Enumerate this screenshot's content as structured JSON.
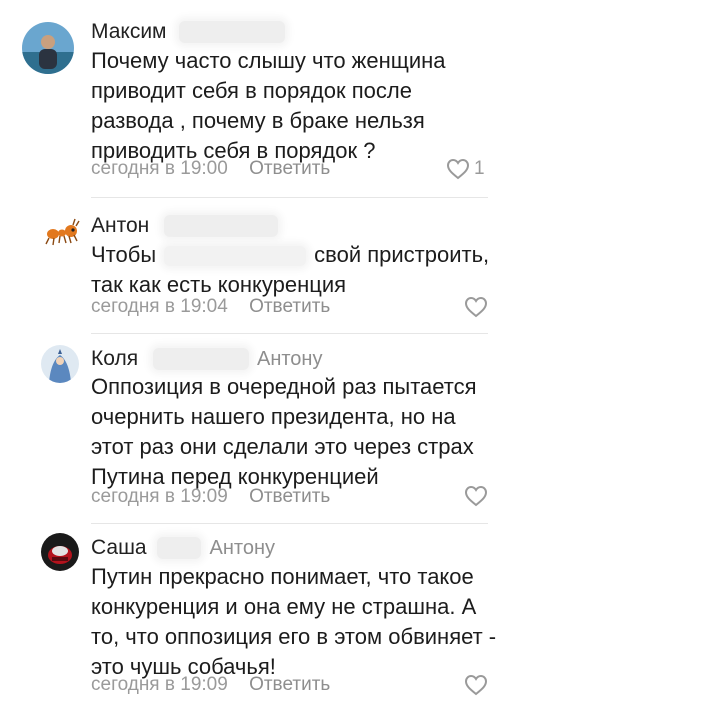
{
  "comments": [
    {
      "author": "Максим",
      "reply_to": "",
      "lines": [
        "Почему часто слышу что женщина",
        "приводит себя в порядок после",
        "развода , почему в браке нельзя",
        "приводить себя в порядок ?"
      ],
      "time": "сегодня в 19:00",
      "reply_label": "Ответить",
      "likes": "1"
    },
    {
      "author": "Антон",
      "reply_to": "",
      "lines": [
        {
          "before": "Чтобы",
          "after": "свой пристроить,"
        },
        "так как есть конкуренция"
      ],
      "time": "сегодня в 19:04",
      "reply_label": "Ответить",
      "likes": ""
    },
    {
      "author": "Коля",
      "reply_to": "Антону",
      "lines": [
        "Оппозиция в очередной раз пытается",
        "очернить нашего президента, но на",
        "этот раз они сделали это через страх",
        "Путина перед конкуренцией"
      ],
      "time": "сегодня в 19:09",
      "reply_label": "Ответить",
      "likes": ""
    },
    {
      "author": "Саша",
      "reply_to": "Антону",
      "lines": [
        "Путин прекрасно понимает, что такое",
        "конкуренция и она ему не страшна. А",
        "то, что оппозиция его в этом обвиняет -",
        "это чушь собачья!"
      ],
      "time": "сегодня в 19:09",
      "reply_label": "Ответить",
      "likes": ""
    }
  ],
  "icons": {
    "like": "heart-outline-icon"
  },
  "colors": {
    "meta": "#9a9a9a",
    "text": "#1c1c1c",
    "author": "#222222"
  }
}
